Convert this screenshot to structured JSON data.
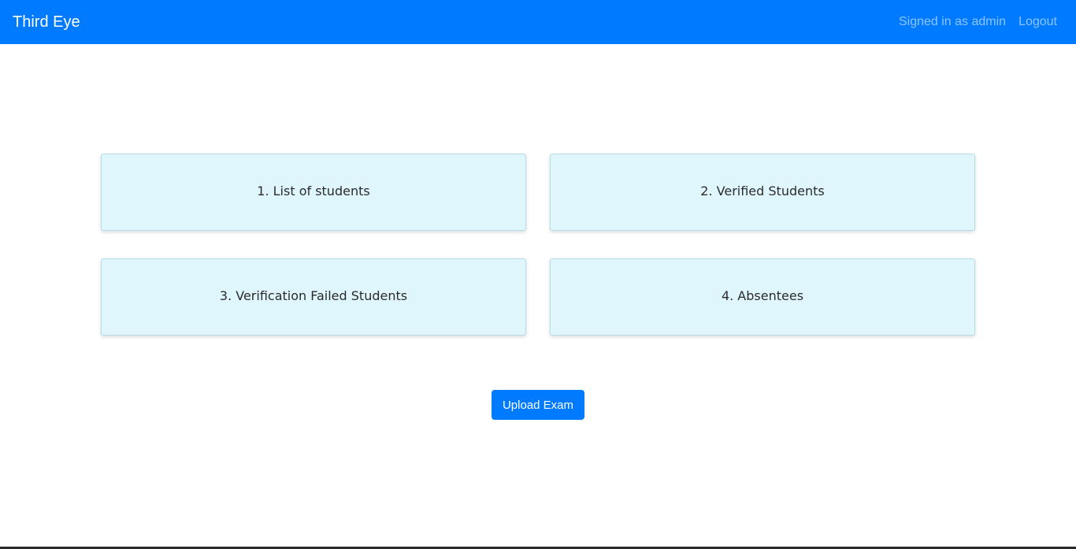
{
  "navbar": {
    "brand": "Third Eye",
    "signed_in_text": "Signed in as admin",
    "logout_label": "Logout",
    "color": "#007bff"
  },
  "cards": [
    {
      "label": "1. List of students"
    },
    {
      "label": "2. Verified Students"
    },
    {
      "label": "3. Verification Failed Students"
    },
    {
      "label": "4. Absentees"
    }
  ],
  "actions": {
    "upload_label": "Upload Exam"
  }
}
